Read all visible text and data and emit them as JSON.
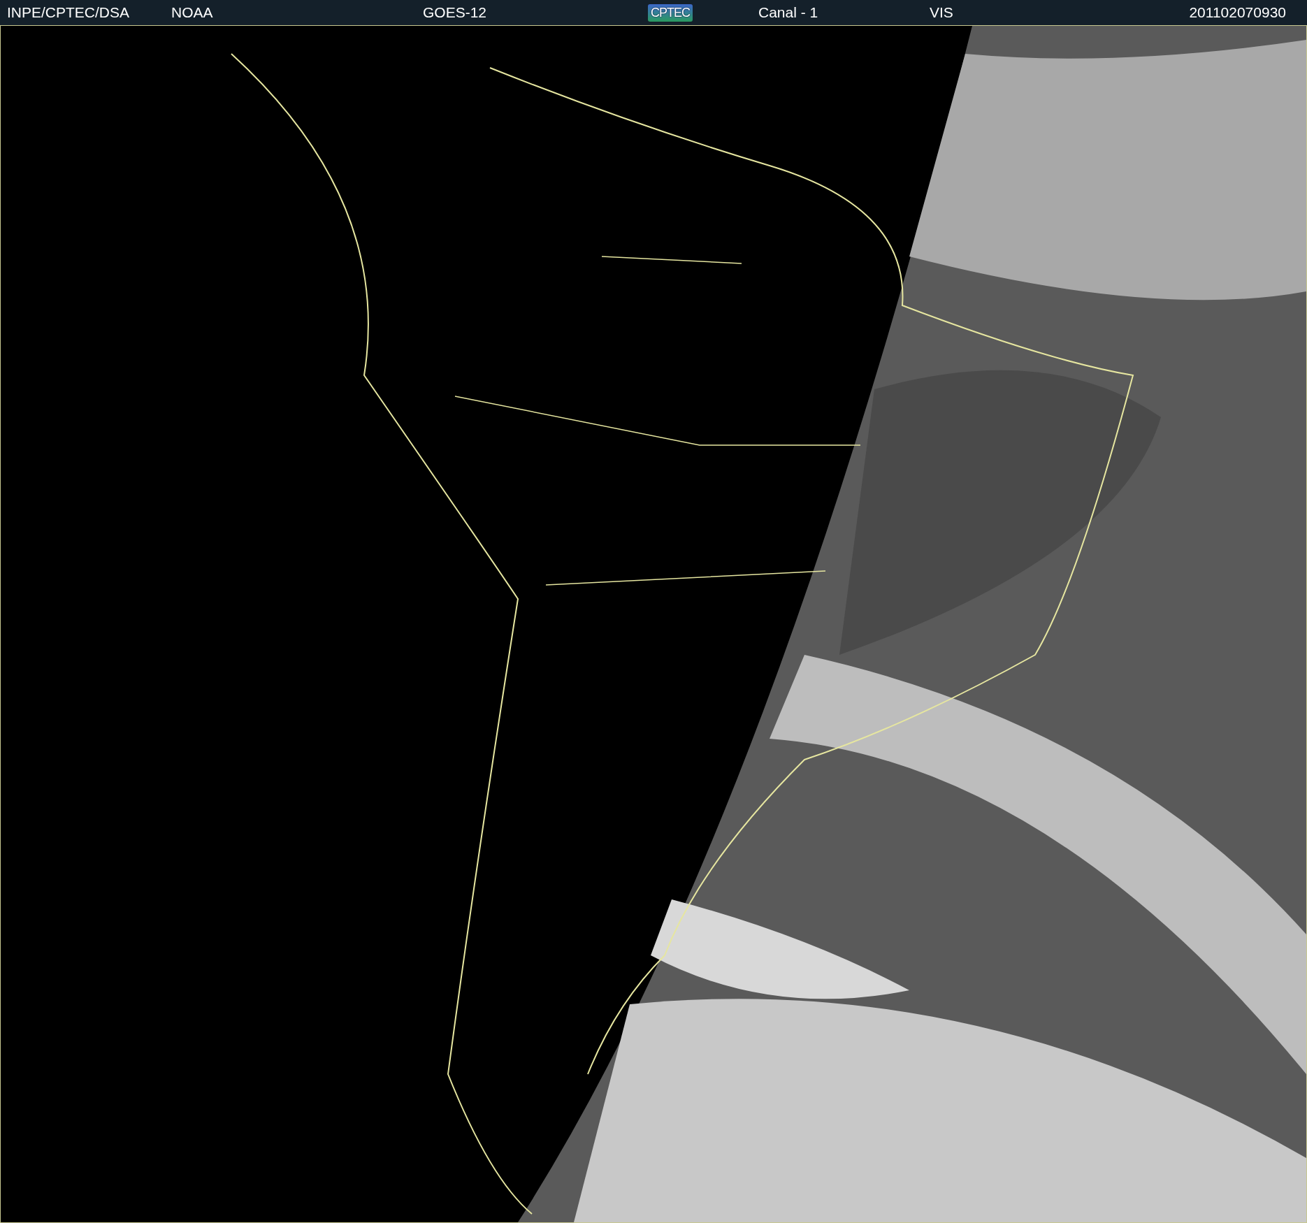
{
  "header": {
    "items": [
      {
        "text": "INPE/CPTEC/DSA",
        "kind": "text"
      },
      {
        "text": "NOAA",
        "kind": "text"
      },
      {
        "text": "GOES-12",
        "kind": "text"
      },
      {
        "text": "CPTEC",
        "kind": "logo"
      },
      {
        "text": "Canal - 1",
        "kind": "text"
      },
      {
        "text": "VIS",
        "kind": "text"
      },
      {
        "text": "201102070930",
        "kind": "text"
      }
    ]
  }
}
